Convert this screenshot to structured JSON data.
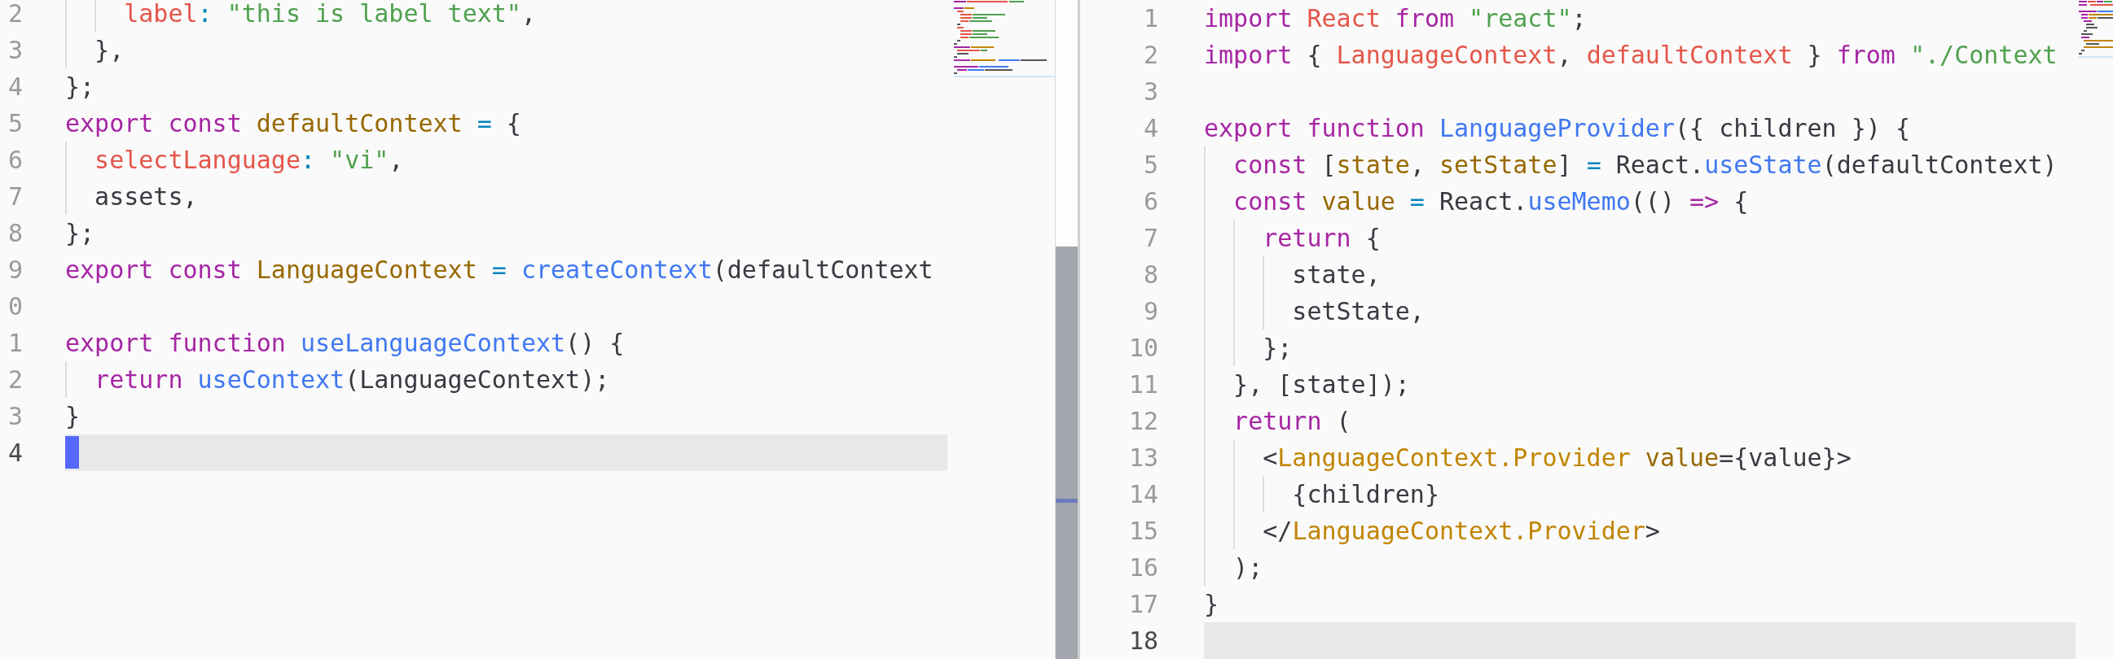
{
  "panes": [
    {
      "focused": true,
      "lines": [
        {
          "number": "2",
          "current": false,
          "tokens": [
            {
              "text": "    label",
              "kind": "property"
            },
            {
              "text": ":",
              "kind": "operator"
            },
            {
              "text": " \"this is label text\"",
              "kind": "string"
            },
            {
              "text": ",",
              "kind": "plain"
            }
          ]
        },
        {
          "number": "3",
          "current": false,
          "tokens": [
            {
              "text": "  },",
              "kind": "plain"
            }
          ]
        },
        {
          "number": "4",
          "current": false,
          "tokens": [
            {
              "text": "};",
              "kind": "plain"
            }
          ]
        },
        {
          "number": "5",
          "current": false,
          "tokens": [
            {
              "text": "export const",
              "kind": "keyword"
            },
            {
              "text": " defaultContext",
              "kind": "variable"
            },
            {
              "text": " =",
              "kind": "operator"
            },
            {
              "text": " {",
              "kind": "plain"
            }
          ]
        },
        {
          "number": "6",
          "current": false,
          "tokens": [
            {
              "text": "  selectLanguage",
              "kind": "property"
            },
            {
              "text": ":",
              "kind": "operator"
            },
            {
              "text": " \"vi\"",
              "kind": "string"
            },
            {
              "text": ",",
              "kind": "plain"
            }
          ]
        },
        {
          "number": "7",
          "current": false,
          "tokens": [
            {
              "text": "  assets,",
              "kind": "plain"
            }
          ]
        },
        {
          "number": "8",
          "current": false,
          "tokens": [
            {
              "text": "};",
              "kind": "plain"
            }
          ]
        },
        {
          "number": "9",
          "current": false,
          "tokens": [
            {
              "text": "export const",
              "kind": "keyword"
            },
            {
              "text": " LanguageContext",
              "kind": "variable"
            },
            {
              "text": " =",
              "kind": "operator"
            },
            {
              "text": " createContext",
              "kind": "function"
            },
            {
              "text": "(defaultContext",
              "kind": "plain"
            }
          ]
        },
        {
          "number": "0",
          "current": false
        },
        {
          "number": "1",
          "current": false,
          "tokens": [
            {
              "text": "export function",
              "kind": "keyword"
            },
            {
              "text": " useLanguageContext",
              "kind": "function"
            },
            {
              "text": "() {",
              "kind": "plain"
            }
          ]
        },
        {
          "number": "2",
          "current": false,
          "tokens": [
            {
              "text": "  return",
              "kind": "keyword"
            },
            {
              "text": " useContext",
              "kind": "function"
            },
            {
              "text": "(LanguageContext);",
              "kind": "plain"
            }
          ]
        },
        {
          "number": "3",
          "current": false,
          "tokens": [
            {
              "text": "}",
              "kind": "plain"
            }
          ]
        },
        {
          "number": "4",
          "current": true
        }
      ]
    },
    {
      "focused": false,
      "lines": [
        {
          "number": "1",
          "current": false,
          "tokens": [
            {
              "text": "import",
              "kind": "keyword"
            },
            {
              "text": " React",
              "kind": "property"
            },
            {
              "text": " from",
              "kind": "keyword"
            },
            {
              "text": " \"react\"",
              "kind": "string"
            },
            {
              "text": ";",
              "kind": "plain"
            }
          ]
        },
        {
          "number": "2",
          "current": false,
          "tokens": [
            {
              "text": "import",
              "kind": "keyword"
            },
            {
              "text": " { ",
              "kind": "plain"
            },
            {
              "text": "LanguageContext",
              "kind": "property"
            },
            {
              "text": ", ",
              "kind": "plain"
            },
            {
              "text": "defaultContext",
              "kind": "property"
            },
            {
              "text": " } ",
              "kind": "plain"
            },
            {
              "text": "from",
              "kind": "keyword"
            },
            {
              "text": " \"./Context",
              "kind": "string"
            }
          ]
        },
        {
          "number": "3",
          "current": false
        },
        {
          "number": "4",
          "current": false,
          "tokens": [
            {
              "text": "export function",
              "kind": "keyword"
            },
            {
              "text": " LanguageProvider",
              "kind": "function"
            },
            {
              "text": "({ children }) {",
              "kind": "plain"
            }
          ]
        },
        {
          "number": "5",
          "current": false,
          "tokens": [
            {
              "text": "  const",
              "kind": "keyword"
            },
            {
              "text": " [",
              "kind": "plain"
            },
            {
              "text": "state",
              "kind": "variable"
            },
            {
              "text": ", ",
              "kind": "plain"
            },
            {
              "text": "setState",
              "kind": "variable"
            },
            {
              "text": "] ",
              "kind": "plain"
            },
            {
              "text": "=",
              "kind": "operator"
            },
            {
              "text": " React.",
              "kind": "plain"
            },
            {
              "text": "useState",
              "kind": "function"
            },
            {
              "text": "(defaultContext)",
              "kind": "plain"
            }
          ]
        },
        {
          "number": "6",
          "current": false,
          "tokens": [
            {
              "text": "  const",
              "kind": "keyword"
            },
            {
              "text": " value",
              "kind": "variable"
            },
            {
              "text": " =",
              "kind": "operator"
            },
            {
              "text": " React.",
              "kind": "plain"
            },
            {
              "text": "useMemo",
              "kind": "function"
            },
            {
              "text": "(() ",
              "kind": "plain"
            },
            {
              "text": "=>",
              "kind": "keyword"
            },
            {
              "text": " {",
              "kind": "plain"
            }
          ]
        },
        {
          "number": "7",
          "current": false,
          "tokens": [
            {
              "text": "    return",
              "kind": "keyword"
            },
            {
              "text": " {",
              "kind": "plain"
            }
          ]
        },
        {
          "number": "8",
          "current": false,
          "tokens": [
            {
              "text": "      state,",
              "kind": "plain"
            }
          ]
        },
        {
          "number": "9",
          "current": false,
          "tokens": [
            {
              "text": "      setState,",
              "kind": "plain"
            }
          ]
        },
        {
          "number": "10",
          "current": false,
          "tokens": [
            {
              "text": "    };",
              "kind": "plain"
            }
          ]
        },
        {
          "number": "11",
          "current": false,
          "tokens": [
            {
              "text": "  }, [state]);",
              "kind": "plain"
            }
          ]
        },
        {
          "number": "12",
          "current": false,
          "tokens": [
            {
              "text": "  return",
              "kind": "keyword"
            },
            {
              "text": " (",
              "kind": "plain"
            }
          ]
        },
        {
          "number": "13",
          "current": false,
          "tokens": [
            {
              "text": "    <",
              "kind": "plain"
            },
            {
              "text": "LanguageContext.Provider",
              "kind": "tag"
            },
            {
              "text": " value",
              "kind": "variable"
            },
            {
              "text": "={value}>",
              "kind": "plain"
            }
          ]
        },
        {
          "number": "14",
          "current": false,
          "tokens": [
            {
              "text": "      {children}",
              "kind": "plain"
            }
          ]
        },
        {
          "number": "15",
          "current": false,
          "tokens": [
            {
              "text": "    </",
              "kind": "plain"
            },
            {
              "text": "LanguageContext.Provider",
              "kind": "tag"
            },
            {
              "text": ">",
              "kind": "plain"
            }
          ]
        },
        {
          "number": "16",
          "current": false,
          "tokens": [
            {
              "text": "  );",
              "kind": "plain"
            }
          ]
        },
        {
          "number": "17",
          "current": false,
          "tokens": [
            {
              "text": "}",
              "kind": "plain"
            }
          ]
        },
        {
          "number": "18",
          "current": true
        }
      ]
    }
  ]
}
